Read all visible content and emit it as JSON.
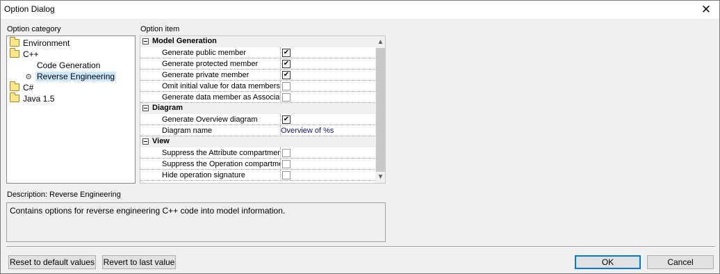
{
  "window": {
    "title": "Option Dialog"
  },
  "category": {
    "label": "Option category",
    "items": [
      {
        "label": "Environment",
        "icon": "folder-icon",
        "level": 0
      },
      {
        "label": "C++",
        "icon": "folder-icon",
        "level": 0
      },
      {
        "label": "Code Generation",
        "icon": "none",
        "level": 1
      },
      {
        "label": "Reverse Engineering",
        "icon": "gear-icon",
        "level": 1,
        "selected": true
      },
      {
        "label": "C#",
        "icon": "folder-icon",
        "level": 0
      },
      {
        "label": "Java 1.5",
        "icon": "folder-icon",
        "level": 0
      }
    ]
  },
  "options": {
    "label": "Option item",
    "groups": [
      {
        "name": "Model Generation",
        "items": [
          {
            "name": "Generate public member",
            "type": "check",
            "checked": true
          },
          {
            "name": "Generate protected member",
            "type": "check",
            "checked": true
          },
          {
            "name": "Generate private member",
            "type": "check",
            "checked": true
          },
          {
            "name": "Omit initial value for data members",
            "type": "check",
            "checked": false
          },
          {
            "name": "Generate data member as Association",
            "type": "check",
            "checked": false
          }
        ]
      },
      {
        "name": "Diagram",
        "items": [
          {
            "name": "Generate Overview diagram",
            "type": "check",
            "checked": true
          },
          {
            "name": "Diagram name",
            "type": "text",
            "value": "Overview of %s"
          }
        ]
      },
      {
        "name": "View",
        "items": [
          {
            "name": "Suppress the Attribute compartment",
            "type": "check",
            "checked": false
          },
          {
            "name": "Suppress the Operation compartment",
            "type": "check",
            "checked": false
          },
          {
            "name": "Hide operation signature",
            "type": "check",
            "checked": false
          }
        ]
      }
    ]
  },
  "description": {
    "label": "Description: Reverse Engineering",
    "text": "Contains options for reverse engineering C++ code into model information."
  },
  "buttons": {
    "reset": "Reset to default values",
    "revert": "Revert to last value",
    "ok": "OK",
    "cancel": "Cancel"
  },
  "colors": {
    "selection": "#cce8ff",
    "value_text": "#13136e",
    "accent": "#0078d7"
  }
}
